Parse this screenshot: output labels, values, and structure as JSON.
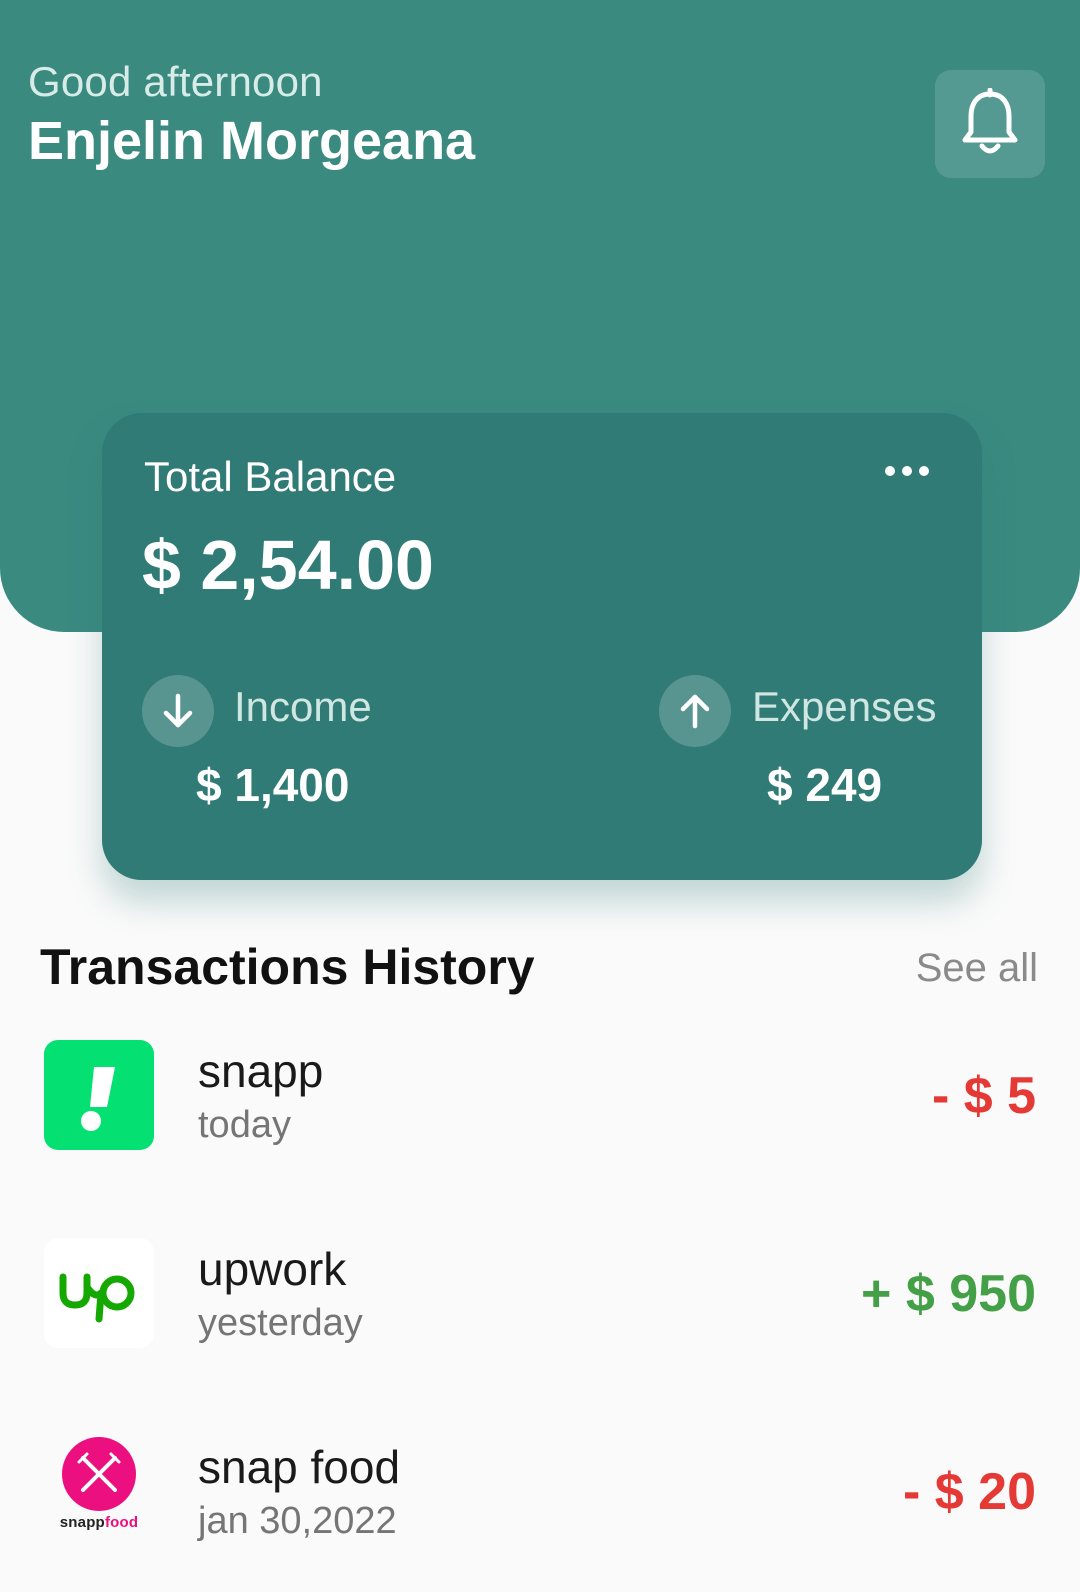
{
  "header": {
    "greeting": "Good afternoon",
    "user_name": "Enjelin Morgeana",
    "notifications_icon": "bell-icon"
  },
  "balance_card": {
    "title": "Total Balance",
    "amount": "$ 2,54.00",
    "menu_icon": "more-horizontal-icon",
    "income": {
      "label": "Income",
      "amount": "$ 1,400",
      "icon": "arrow-down-icon"
    },
    "expenses": {
      "label": "Expenses",
      "amount": "$ 249",
      "icon": "arrow-up-icon"
    }
  },
  "transactions": {
    "title": "Transactions History",
    "see_all_label": "See all",
    "items": [
      {
        "name": "snapp",
        "date": "today",
        "amount": "- $ 5",
        "type": "expense",
        "logo": "snapp-logo"
      },
      {
        "name": "upwork",
        "date": "yesterday",
        "amount": "+ $ 950",
        "type": "income",
        "logo": "upwork-logo"
      },
      {
        "name": "snap food",
        "date": "jan 30,2022",
        "amount": "- $ 20",
        "type": "expense",
        "logo": "snappfood-logo",
        "logo_caption_dark": "snapp",
        "logo_caption_accent": "food"
      }
    ]
  },
  "colors": {
    "header_bg": "#3a8a80",
    "card_bg": "#307b75",
    "income": "#43a047",
    "expense": "#e53935",
    "snapp_green": "#05e072",
    "upwork_green": "#14a800",
    "snappfood_pink": "#ec0f80"
  }
}
